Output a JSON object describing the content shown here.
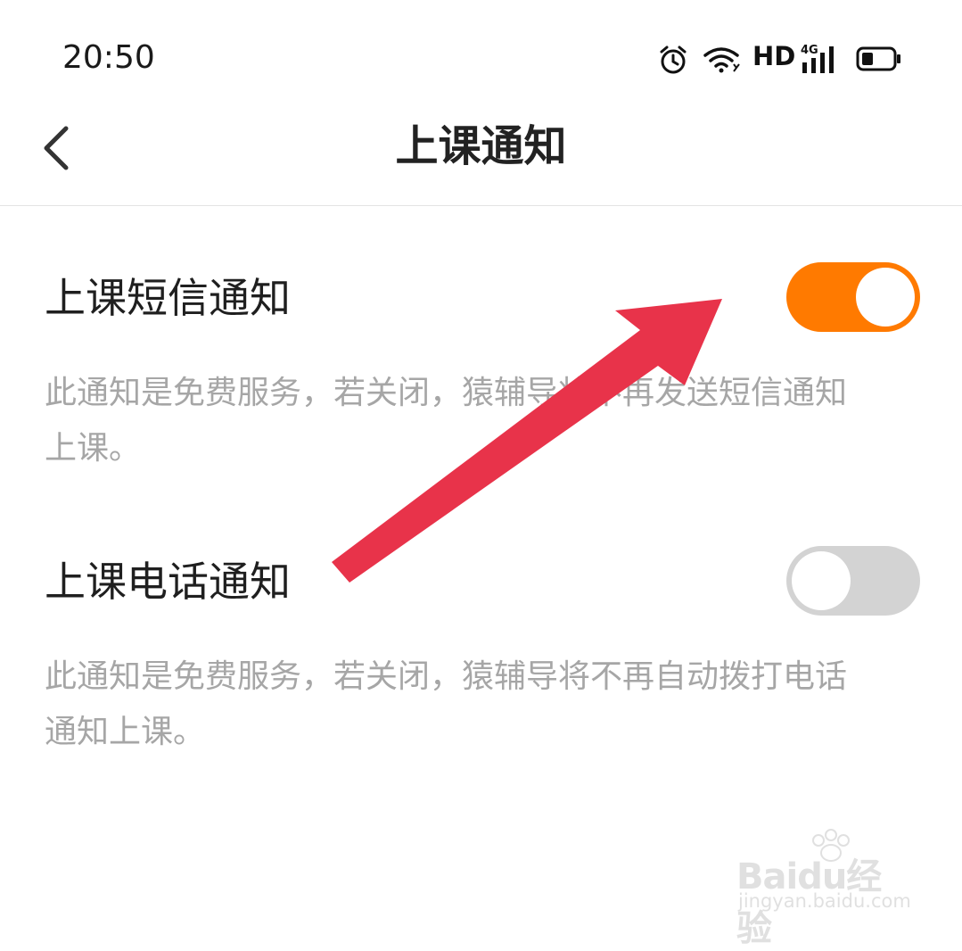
{
  "status_bar": {
    "time": "20:50",
    "network_label": "HD",
    "signal_label": "4G",
    "icons": [
      "alarm-icon",
      "wifi-icon",
      "signal-icon",
      "battery-icon"
    ]
  },
  "header": {
    "title": "上课通知",
    "back_icon": "chevron-left-icon"
  },
  "settings": [
    {
      "label": "上课短信通知",
      "description_line1": "此通知是免费服务，若关闭，猿辅导将不再发送短信通知",
      "description_line2": "上课。",
      "enabled": true
    },
    {
      "label": "上课电话通知",
      "description_line1": "此通知是免费服务，若关闭，猿辅导将不再自动拨打电话",
      "description_line2": "通知上课。",
      "enabled": false
    }
  ],
  "colors": {
    "toggle_on": "#FF7A00",
    "toggle_off": "#D3D3D3",
    "annotation_arrow": "#E8334A"
  },
  "watermark": {
    "brand": "Baidu经验",
    "url": "jingyan.baidu.com"
  }
}
